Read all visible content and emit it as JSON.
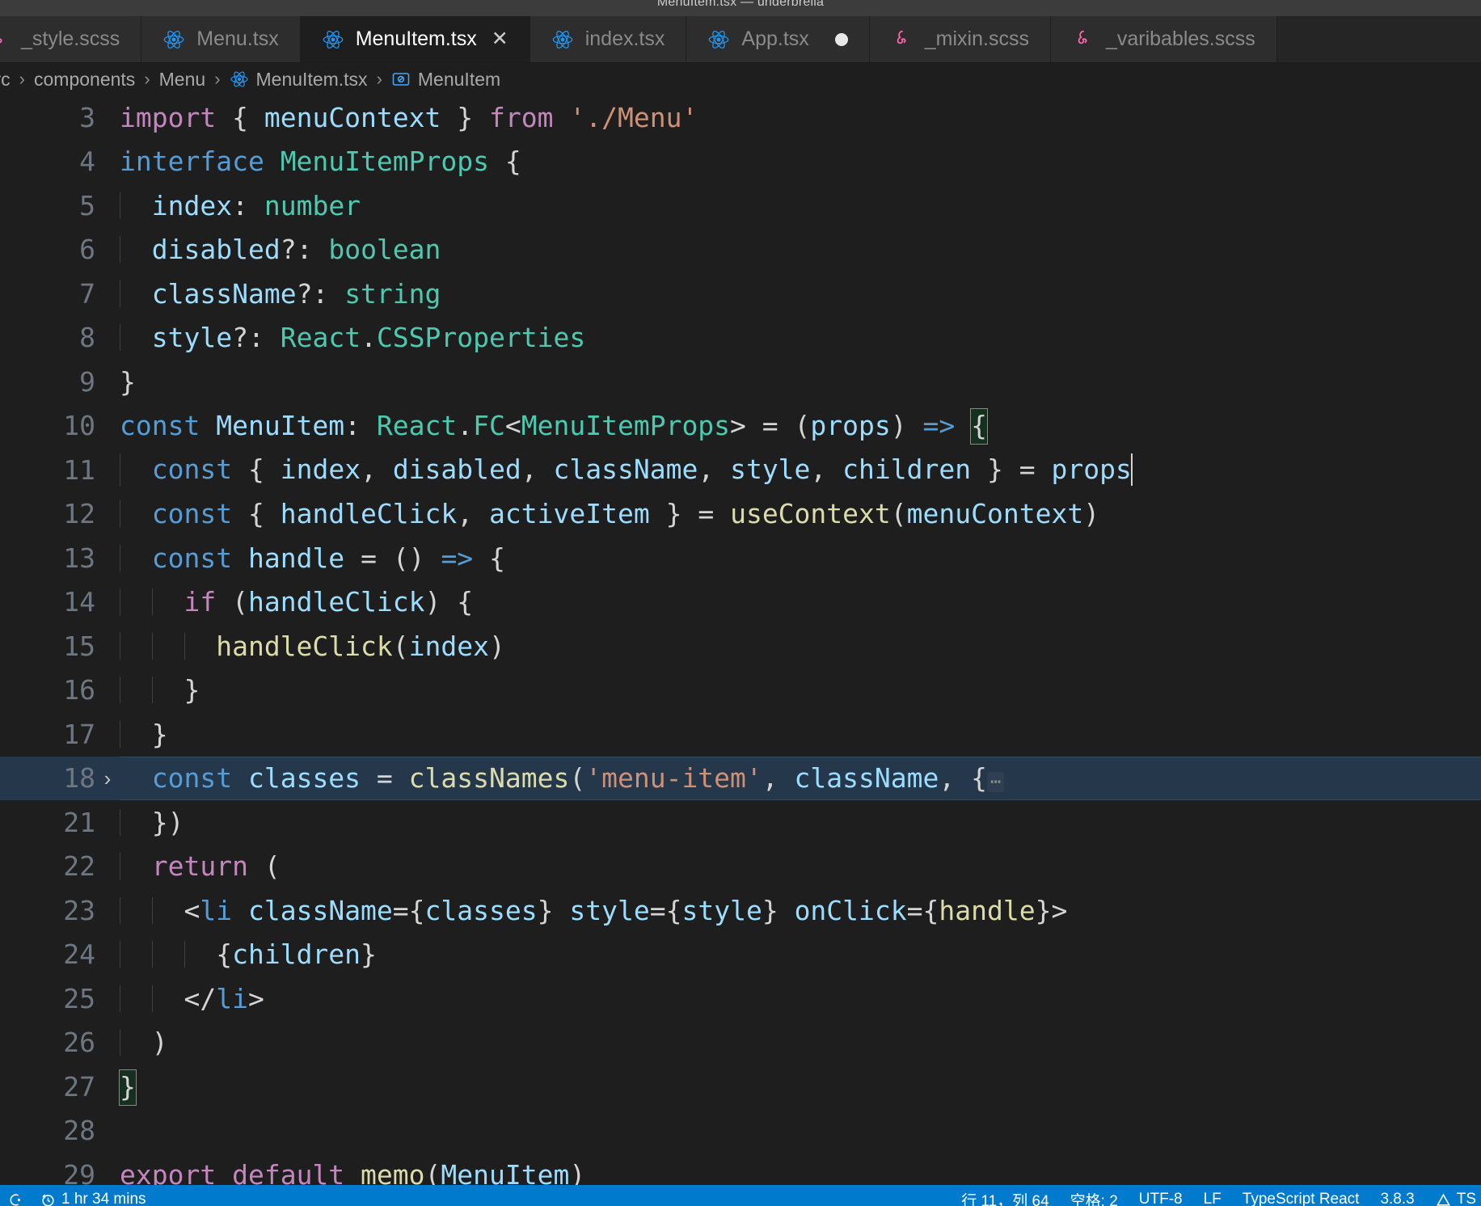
{
  "window": {
    "title": "MenuItem.tsx — underbrella"
  },
  "tabs": [
    {
      "label": "_style.scss",
      "icon": "sass-icon",
      "active": false,
      "modified": false,
      "closable": false,
      "partial": true
    },
    {
      "label": "Menu.tsx",
      "icon": "react-icon",
      "active": false,
      "modified": false,
      "closable": false,
      "partial": false
    },
    {
      "label": "MenuItem.tsx",
      "icon": "react-icon",
      "active": true,
      "modified": false,
      "closable": true,
      "close_label": "✕",
      "partial": false
    },
    {
      "label": "index.tsx",
      "icon": "react-icon",
      "active": false,
      "modified": false,
      "closable": false,
      "partial": false
    },
    {
      "label": "App.tsx",
      "icon": "react-icon",
      "active": false,
      "modified": true,
      "closable": false,
      "partial": false
    },
    {
      "label": "_mixin.scss",
      "icon": "sass-icon",
      "active": false,
      "modified": false,
      "closable": false,
      "partial": false
    },
    {
      "label": "_varibables.scss",
      "icon": "sass-icon",
      "active": false,
      "modified": false,
      "closable": false,
      "partial": false
    }
  ],
  "breadcrumbs": [
    {
      "label": "src",
      "icon": null
    },
    {
      "label": "components",
      "icon": null
    },
    {
      "label": "Menu",
      "icon": null
    },
    {
      "label": "MenuItem.tsx",
      "icon": "react-icon"
    },
    {
      "label": "MenuItem",
      "icon": "symbol-variable-icon"
    }
  ],
  "breadcrumb_separator": "›",
  "editor": {
    "fold_ellipsis": "⋯",
    "fold_chevron": "›",
    "lines": [
      {
        "num": "3",
        "indent": 0
      },
      {
        "num": "4",
        "indent": 0
      },
      {
        "num": "5",
        "indent": 1
      },
      {
        "num": "6",
        "indent": 1
      },
      {
        "num": "7",
        "indent": 1
      },
      {
        "num": "8",
        "indent": 1
      },
      {
        "num": "9",
        "indent": 0
      },
      {
        "num": "10",
        "indent": 0
      },
      {
        "num": "11",
        "indent": 1
      },
      {
        "num": "12",
        "indent": 1
      },
      {
        "num": "13",
        "indent": 1
      },
      {
        "num": "14",
        "indent": 2
      },
      {
        "num": "15",
        "indent": 3
      },
      {
        "num": "16",
        "indent": 2
      },
      {
        "num": "17",
        "indent": 1
      },
      {
        "num": "18",
        "indent": 1
      },
      {
        "num": "21",
        "indent": 1
      },
      {
        "num": "22",
        "indent": 1
      },
      {
        "num": "23",
        "indent": 2
      },
      {
        "num": "24",
        "indent": 3
      },
      {
        "num": "25",
        "indent": 2
      },
      {
        "num": "26",
        "indent": 1
      },
      {
        "num": "27",
        "indent": 0
      },
      {
        "num": "28",
        "indent": 0
      },
      {
        "num": "29",
        "indent": 0
      }
    ],
    "source_text": [
      "import { menuContext } from './Menu'",
      "interface MenuItemProps {",
      "  index: number",
      "  disabled?: boolean",
      "  className?: string",
      "  style?: React.CSSProperties",
      "}",
      "const MenuItem: React.FC<MenuItemProps> = (props) => {",
      "  const { index, disabled, className, style, children } = props",
      "  const { handleClick, activeItem } = useContext(menuContext)",
      "  const handle = () => {",
      "    if (handleClick) {",
      "      handleClick(index)",
      "    }",
      "  }",
      "  const classes = classNames('menu-item', className, {⋯",
      "  })",
      "  return (",
      "    <li className={classes} style={style} onClick={handle}>",
      "      {children}",
      "    </li>",
      "  )",
      "}",
      "",
      "export default memo(MenuItem)"
    ]
  },
  "statusbar": {
    "left": [
      {
        "name": "remote-indicator",
        "label": "",
        "icon": "remote-icon"
      },
      {
        "name": "time-tracker",
        "label": "1 hr 34 mins",
        "icon": "clock-icon"
      }
    ],
    "right": [
      {
        "name": "cursor-position",
        "label": "行 11，列 64"
      },
      {
        "name": "indentation",
        "label": "空格: 2"
      },
      {
        "name": "encoding",
        "label": "UTF-8"
      },
      {
        "name": "eol",
        "label": "LF"
      },
      {
        "name": "language-mode",
        "label": "TypeScript React"
      },
      {
        "name": "version",
        "label": "3.8.3"
      },
      {
        "name": "problems",
        "label": "TS",
        "icon": "warning-icon"
      }
    ]
  },
  "colors": {
    "accent": "#007acc",
    "editor_bg": "#1e1e1e",
    "tab_bg": "#2d2d2d",
    "tab_active_bg": "#1e1e1e",
    "titlebar_bg": "#3c3c3c",
    "react_icon": "#2196f3",
    "sass_icon": "#ff69b4",
    "line_highlight": "#25374b"
  }
}
